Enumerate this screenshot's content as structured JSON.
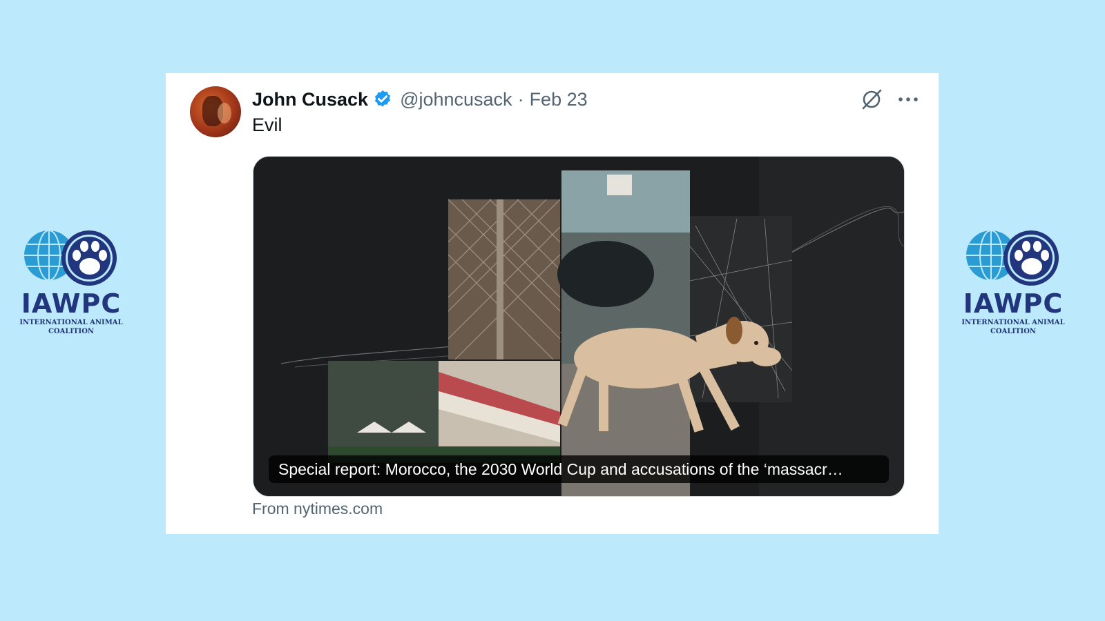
{
  "logo": {
    "name": "IAWPC",
    "subtitle_line1": "INTERNATIONAL ANIMAL",
    "subtitle_line2": "COALITION"
  },
  "tweet": {
    "author_name": "John Cusack",
    "handle": "@johncusack",
    "separator": "·",
    "date": "Feb 23",
    "text": "Evil",
    "card_caption": "Special report: Morocco, the 2030 World Cup and accusations of the ‘massacr…",
    "card_source": "From nytimes.com"
  },
  "icons": {
    "verified": "verified-badge-icon",
    "grok": "grok-icon",
    "more": "more-options-icon"
  },
  "colors": {
    "background": "#bde9fd",
    "logo_blue": "#21367c",
    "globe_blue": "#2b9bd3",
    "verified_blue": "#1d9bf0",
    "card_dark": "#1c1d1e"
  }
}
